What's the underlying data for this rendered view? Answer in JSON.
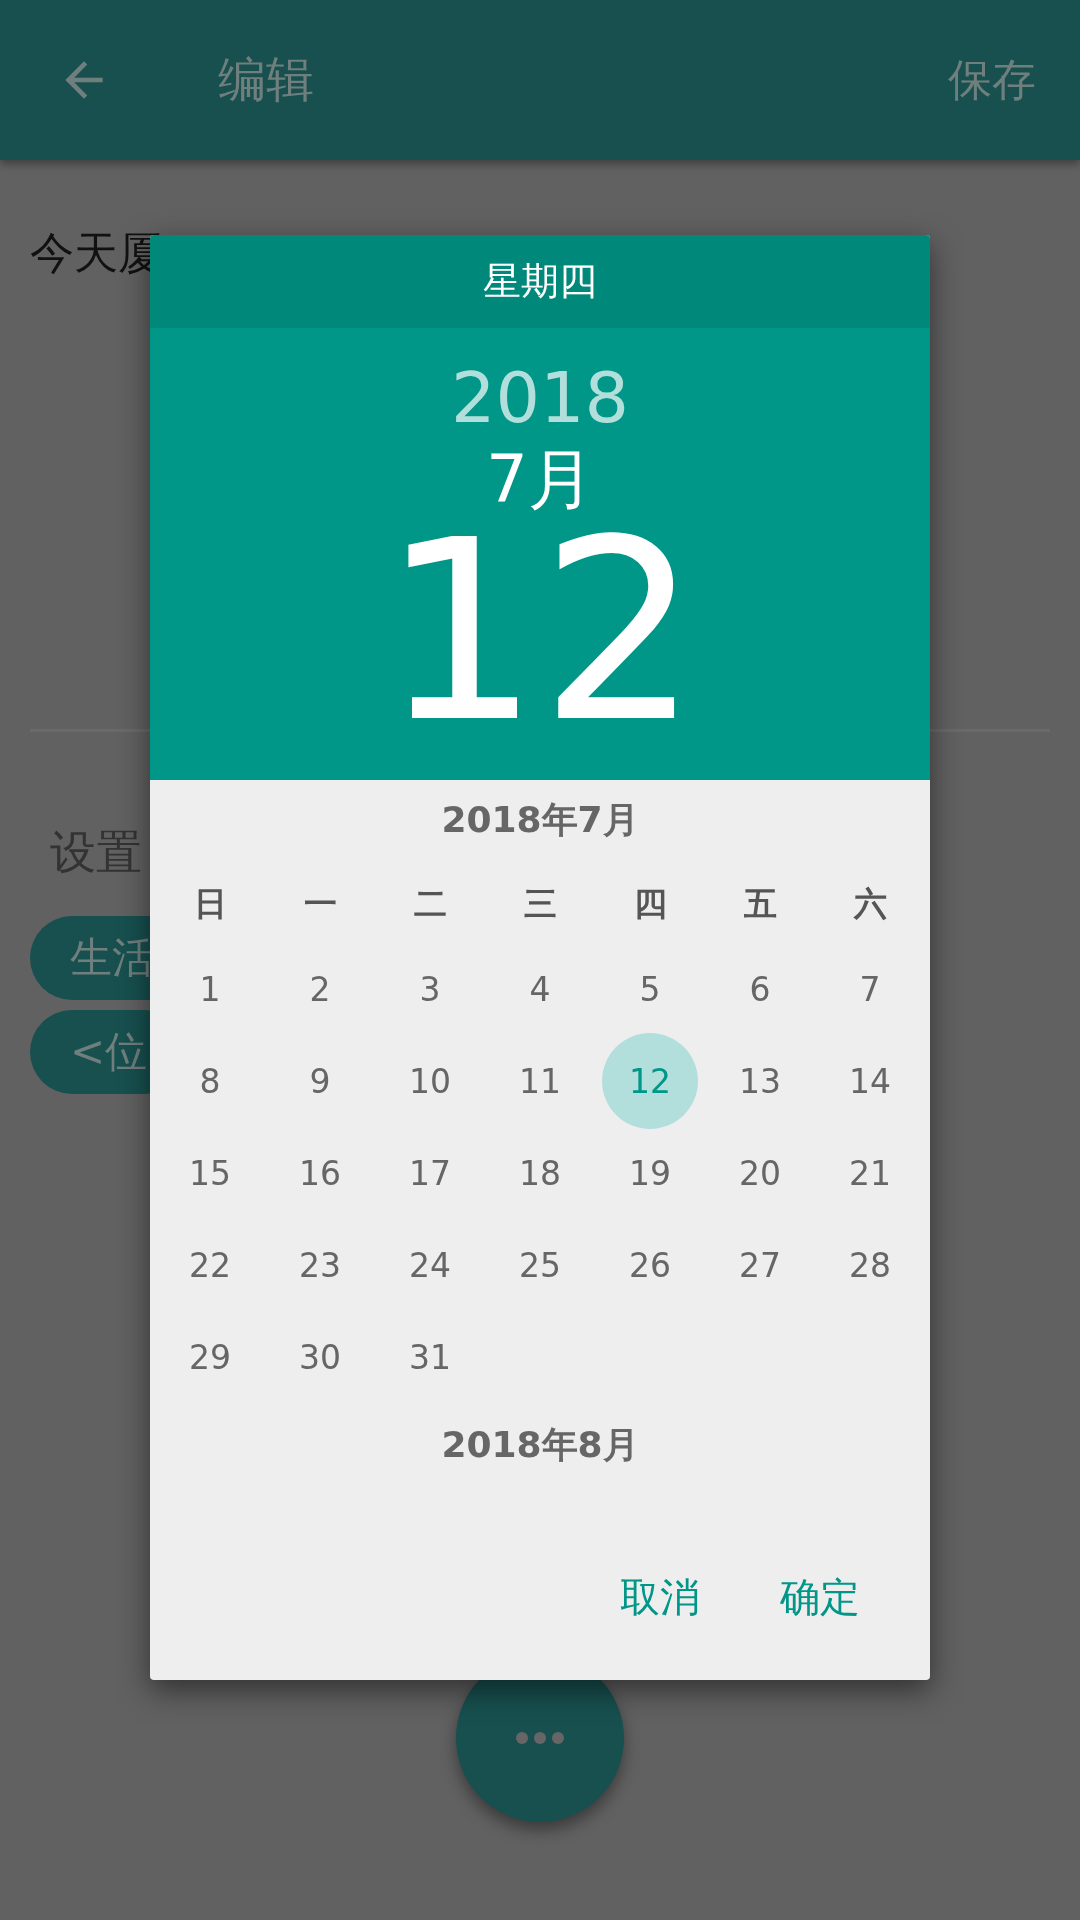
{
  "app_bar": {
    "title": "编辑",
    "action": "保存"
  },
  "editor": {
    "text": "今天厦"
  },
  "settings": {
    "label": "设置",
    "chips": [
      "生活",
      "<位"
    ]
  },
  "dialog": {
    "weekday": "星期四",
    "year": "2018",
    "month": "7月",
    "day": "12",
    "month_title": "2018年7月",
    "weekday_headers": [
      "日",
      "一",
      "二",
      "三",
      "四",
      "五",
      "六"
    ],
    "days": [
      {
        "label": "1",
        "selected": false
      },
      {
        "label": "2",
        "selected": false
      },
      {
        "label": "3",
        "selected": false
      },
      {
        "label": "4",
        "selected": false
      },
      {
        "label": "5",
        "selected": false
      },
      {
        "label": "6",
        "selected": false
      },
      {
        "label": "7",
        "selected": false
      },
      {
        "label": "8",
        "selected": false
      },
      {
        "label": "9",
        "selected": false
      },
      {
        "label": "10",
        "selected": false
      },
      {
        "label": "11",
        "selected": false
      },
      {
        "label": "12",
        "selected": true
      },
      {
        "label": "13",
        "selected": false
      },
      {
        "label": "14",
        "selected": false
      },
      {
        "label": "15",
        "selected": false
      },
      {
        "label": "16",
        "selected": false
      },
      {
        "label": "17",
        "selected": false
      },
      {
        "label": "18",
        "selected": false
      },
      {
        "label": "19",
        "selected": false
      },
      {
        "label": "20",
        "selected": false
      },
      {
        "label": "21",
        "selected": false
      },
      {
        "label": "22",
        "selected": false
      },
      {
        "label": "23",
        "selected": false
      },
      {
        "label": "24",
        "selected": false
      },
      {
        "label": "25",
        "selected": false
      },
      {
        "label": "26",
        "selected": false
      },
      {
        "label": "27",
        "selected": false
      },
      {
        "label": "28",
        "selected": false
      },
      {
        "label": "29",
        "selected": false
      },
      {
        "label": "30",
        "selected": false
      },
      {
        "label": "31",
        "selected": false
      }
    ],
    "next_month_title": "2018年8月",
    "buttons": [
      "取消",
      "确定"
    ]
  }
}
